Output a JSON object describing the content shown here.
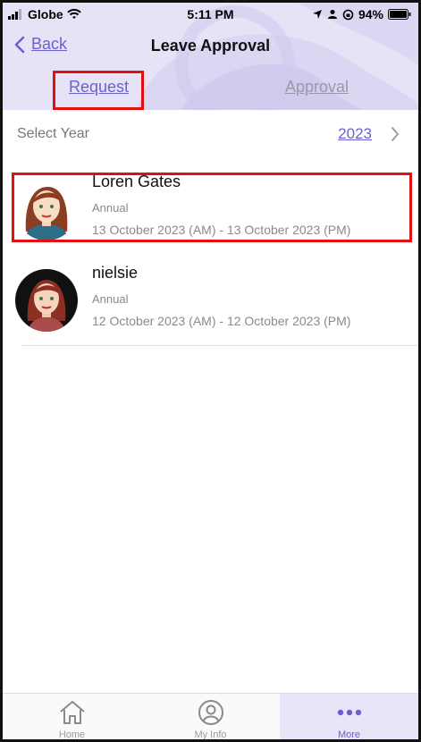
{
  "status_bar": {
    "carrier": "Globe",
    "time": "5:11 PM",
    "battery": "94%"
  },
  "header": {
    "back_label": "Back",
    "title": "Leave Approval"
  },
  "tabs": [
    {
      "label": "Request",
      "active": true
    },
    {
      "label": "Approval",
      "active": false
    }
  ],
  "year_selector": {
    "label": "Select Year",
    "value": "2023"
  },
  "requests": [
    {
      "name": "Loren Gates",
      "type": "Annual",
      "dates": "13 October 2023 (AM) - 13 October 2023 (PM)"
    },
    {
      "name": "nielsie",
      "type": "Annual",
      "dates": "12 October 2023 (AM) - 12 October 2023 (PM)"
    }
  ],
  "tab_bar": [
    {
      "label": "Home",
      "icon": "home-icon"
    },
    {
      "label": "My Info",
      "icon": "user-circle-icon"
    },
    {
      "label": "More",
      "icon": "more-dots-icon",
      "active": true
    }
  ],
  "colors": {
    "accent": "#6a61cf",
    "header_bg": "#e7e3f6",
    "annotation_red": "#e01010"
  }
}
